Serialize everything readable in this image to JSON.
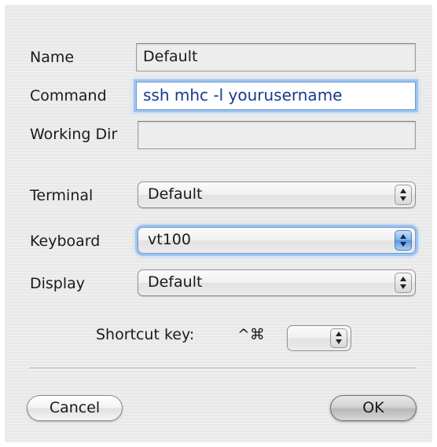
{
  "form": {
    "name_label": "Name",
    "name_value": "Default",
    "command_label": "Command",
    "command_value": "ssh mhc -l yourusername",
    "working_dir_label": "Working Dir",
    "working_dir_value": "",
    "terminal_label": "Terminal",
    "terminal_value": "Default",
    "keyboard_label": "Keyboard",
    "keyboard_value": "vt100",
    "display_label": "Display",
    "display_value": "Default",
    "shortcut_label": "Shortcut key:",
    "shortcut_modifiers": "^⌘",
    "shortcut_value": ""
  },
  "buttons": {
    "cancel_label": "Cancel",
    "ok_label": "OK"
  },
  "colors": {
    "focus_ring": "#9fc4ef",
    "panel_background": "#ececec"
  },
  "icons": {
    "popup_arrows": "updown-arrows-icon"
  }
}
